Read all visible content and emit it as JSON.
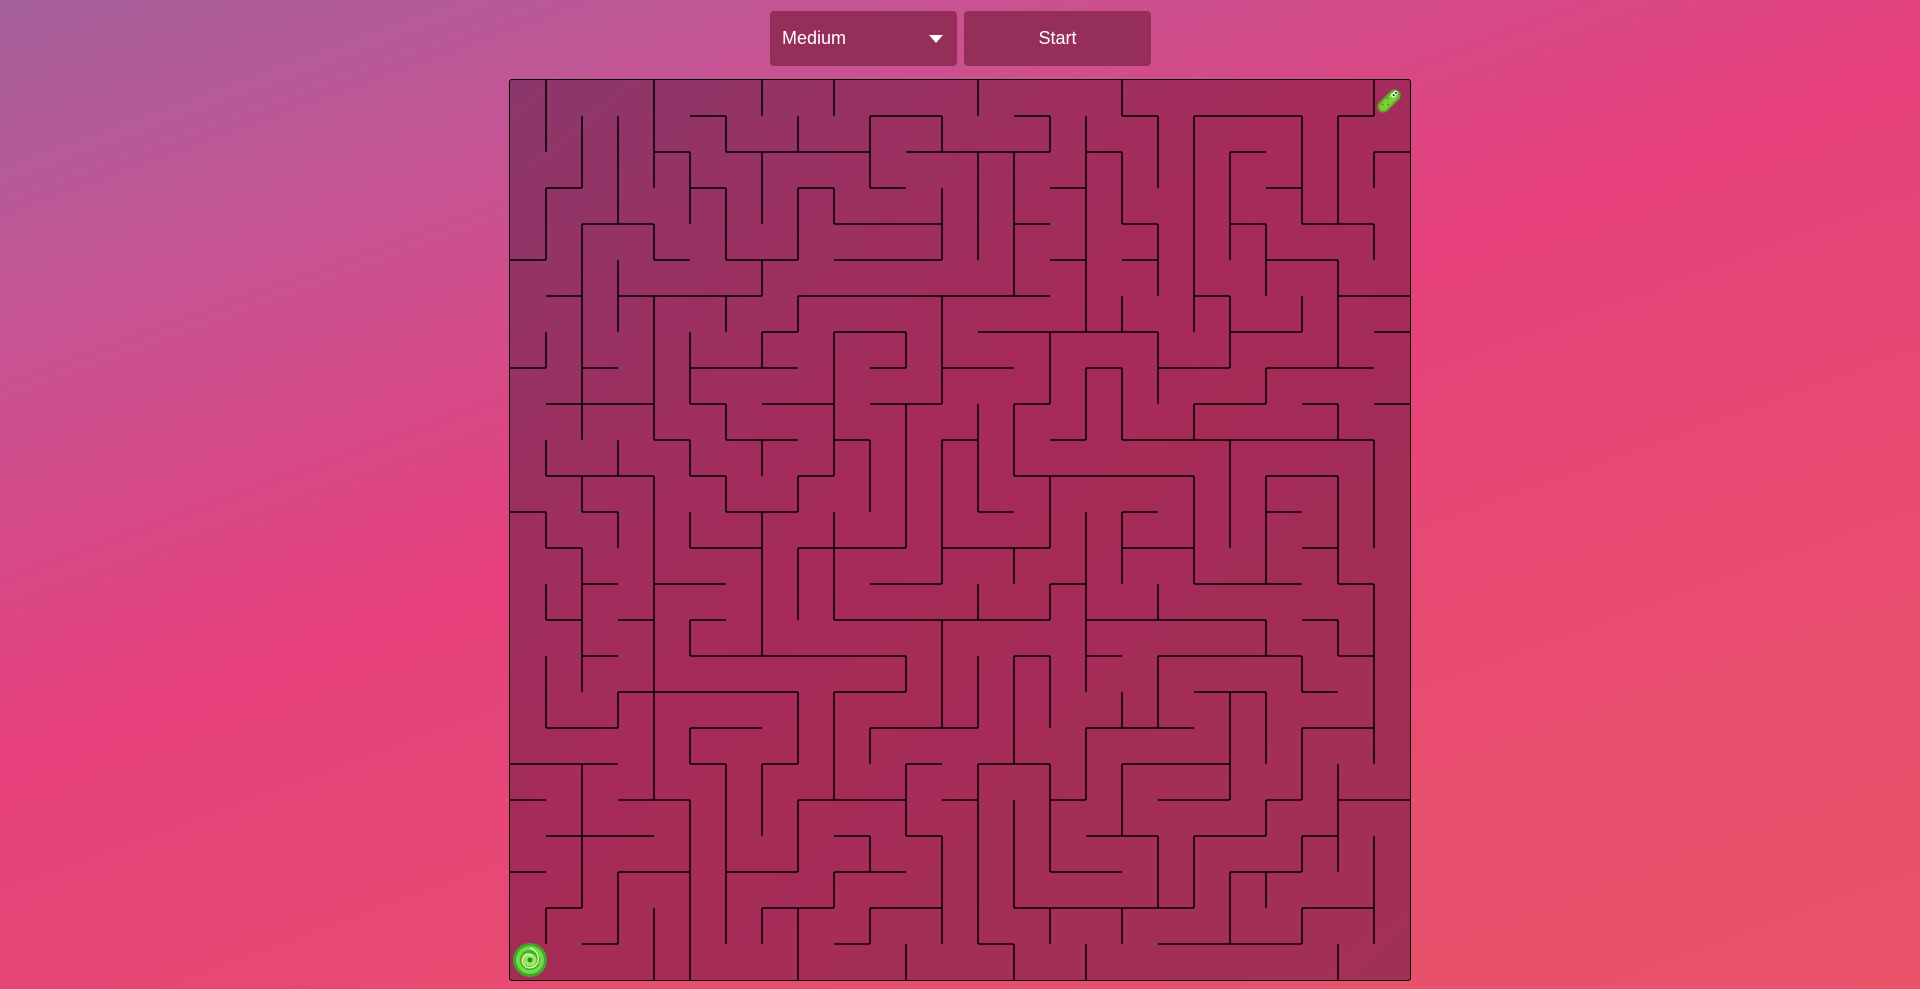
{
  "controls": {
    "difficulty": {
      "selected": "Medium",
      "icon": "chevron-down-icon"
    },
    "start_label": "Start"
  },
  "maze": {
    "goal_icon": "pickle-icon",
    "player_icon": "portal-icon"
  },
  "colors": {
    "button_bg": "#962e5c",
    "maze_bg": "#9b2d5c",
    "wall": "#000000",
    "pickle": "#6bbf2a",
    "portal": "#5fd13a"
  }
}
